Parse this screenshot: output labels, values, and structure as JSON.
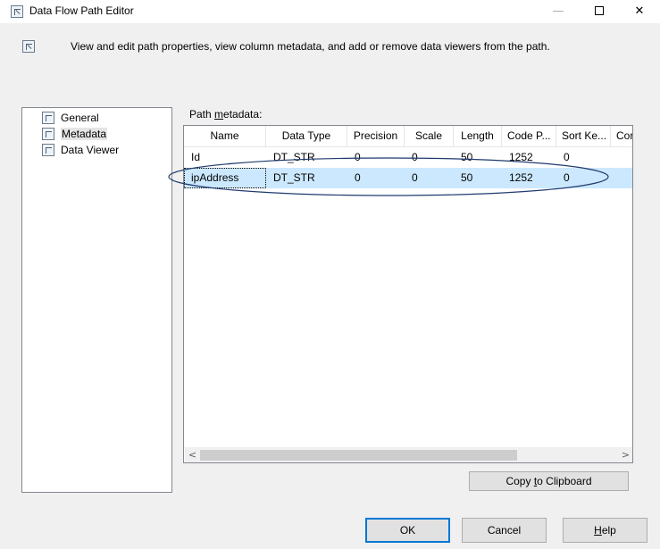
{
  "window": {
    "title": "Data Flow Path Editor",
    "minimize_glyph": "—",
    "close_glyph": "✕"
  },
  "header": {
    "description": "View and edit path properties, view column metadata, and add or remove data viewers from the path."
  },
  "nav": {
    "items": [
      {
        "label": "General",
        "icon": "properties-icon"
      },
      {
        "label": "Metadata",
        "icon": "properties-icon",
        "selected": true
      },
      {
        "label": "Data Viewer",
        "icon": "properties-icon"
      }
    ]
  },
  "metadata": {
    "label_prefix": "Path ",
    "label_mnemonic": "m",
    "label_suffix": "etadata:",
    "columns": [
      "Name",
      "Data Type",
      "Precision",
      "Scale",
      "Length",
      "Code P...",
      "Sort Ke...",
      "Cor"
    ],
    "rows": [
      [
        "Id",
        "DT_STR",
        "0",
        "0",
        "50",
        "1252",
        "0",
        ""
      ],
      [
        "ipAddress",
        "DT_STR",
        "0",
        "0",
        "50",
        "1252",
        "0",
        ""
      ]
    ],
    "selected_row": 1,
    "scroll_left": "<",
    "scroll_right": ">"
  },
  "buttons": {
    "copy_prefix": "Copy ",
    "copy_mnemonic": "t",
    "copy_suffix": "o Clipboard",
    "ok": "OK",
    "cancel": "Cancel",
    "help_mnemonic": "H",
    "help_suffix": "elp"
  },
  "colors": {
    "selection": "#cce8ff",
    "annotation": "#1f3a6e",
    "default_button_border": "#0078d7"
  }
}
